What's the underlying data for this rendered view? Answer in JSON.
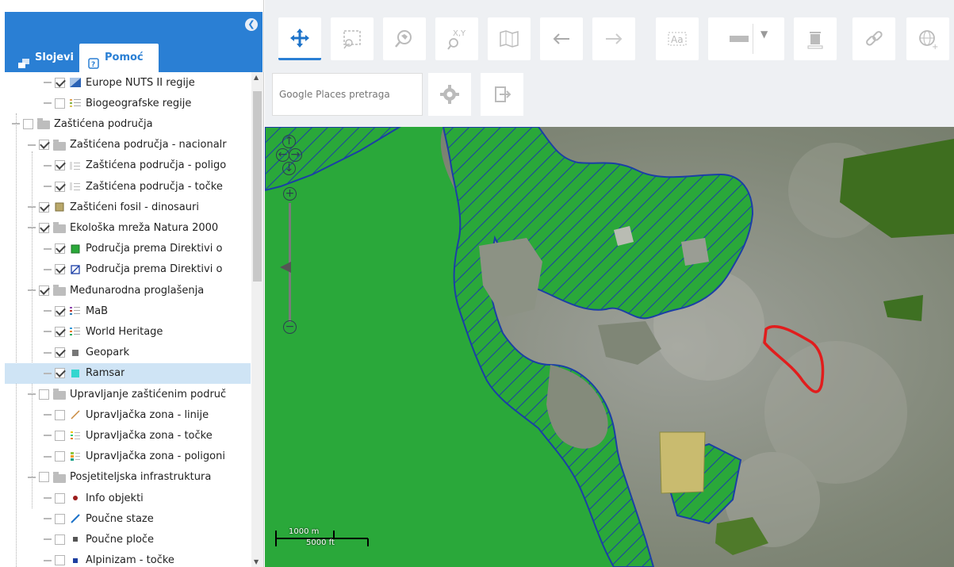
{
  "sidebar": {
    "tabs": [
      {
        "label": "Slojevi"
      },
      {
        "label": "Pomoć"
      }
    ],
    "tree": [
      {
        "label": "Europe NUTS II regije",
        "level": 2,
        "checked": true,
        "icon": "nuts-region-icon"
      },
      {
        "label": "Biogeografske regije",
        "level": 2,
        "checked": false,
        "icon": "biogeographic-legend-icon"
      },
      {
        "label": "Zaštićena područja",
        "level": 0,
        "checked": false,
        "icon": "folder-icon"
      },
      {
        "label": "Zaštićena područja - nacionalr",
        "level": 1,
        "checked": true,
        "icon": "folder-icon"
      },
      {
        "label": "Zaštićena područja - poligo",
        "level": 2,
        "checked": true,
        "icon": "legend-lines-icon"
      },
      {
        "label": "Zaštićena područja - točke",
        "level": 2,
        "checked": true,
        "icon": "legend-lines-icon"
      },
      {
        "label": "Zaštićeni fosil - dinosauri",
        "level": 1,
        "checked": true,
        "icon": "fossil-square-icon"
      },
      {
        "label": "Ekološka mreža Natura 2000",
        "level": 1,
        "checked": true,
        "icon": "folder-icon"
      },
      {
        "label": "Područja prema Direktivi o",
        "level": 2,
        "checked": true,
        "icon": "green-square-icon"
      },
      {
        "label": "Područja prema Direktivi o",
        "level": 2,
        "checked": true,
        "icon": "hatched-square-icon"
      },
      {
        "label": "Međunarodna proglašenja",
        "level": 1,
        "checked": true,
        "icon": "folder-icon"
      },
      {
        "label": "MaB",
        "level": 2,
        "checked": true,
        "icon": "mab-legend-icon"
      },
      {
        "label": "World Heritage",
        "level": 2,
        "checked": true,
        "icon": "world-heritage-legend-icon"
      },
      {
        "label": "Geopark",
        "level": 2,
        "checked": true,
        "icon": "grey-square-icon"
      },
      {
        "label": "Ramsar",
        "level": 2,
        "checked": true,
        "icon": "cyan-square-icon",
        "selected": true
      },
      {
        "label": "Upravljanje zaštićenim područ",
        "level": 1,
        "checked": false,
        "icon": "folder-icon"
      },
      {
        "label": "Upravljačka zona - linije",
        "level": 2,
        "checked": false,
        "icon": "line-legend-icon"
      },
      {
        "label": "Upravljačka zona - točke",
        "level": 2,
        "checked": false,
        "icon": "points-legend-icon"
      },
      {
        "label": "Upravljačka zona - poligoni",
        "level": 2,
        "checked": false,
        "icon": "polygons-legend-icon"
      },
      {
        "label": "Posjetiteljska infrastruktura",
        "level": 1,
        "checked": false,
        "icon": "folder-icon"
      },
      {
        "label": "Info objekti",
        "level": 2,
        "checked": false,
        "icon": "red-dot-icon"
      },
      {
        "label": "Poučne staze",
        "level": 2,
        "checked": false,
        "icon": "blue-line-icon"
      },
      {
        "label": "Poučne ploče",
        "level": 2,
        "checked": false,
        "icon": "small-square-icon"
      },
      {
        "label": "Alpinizam - točke",
        "level": 2,
        "checked": false,
        "icon": "blue-small-square-icon"
      }
    ]
  },
  "toolbar": {
    "search_placeholder": "Google Places pretraga"
  },
  "map": {
    "scale_metric": "1000 m",
    "scale_imperial": "5000 ft"
  },
  "colors": {
    "accent": "#2a7fd4",
    "natura_green": "#2aa83a",
    "ramsar_outline": "#e11d1d",
    "hatch_blue": "#1f4fbf"
  }
}
